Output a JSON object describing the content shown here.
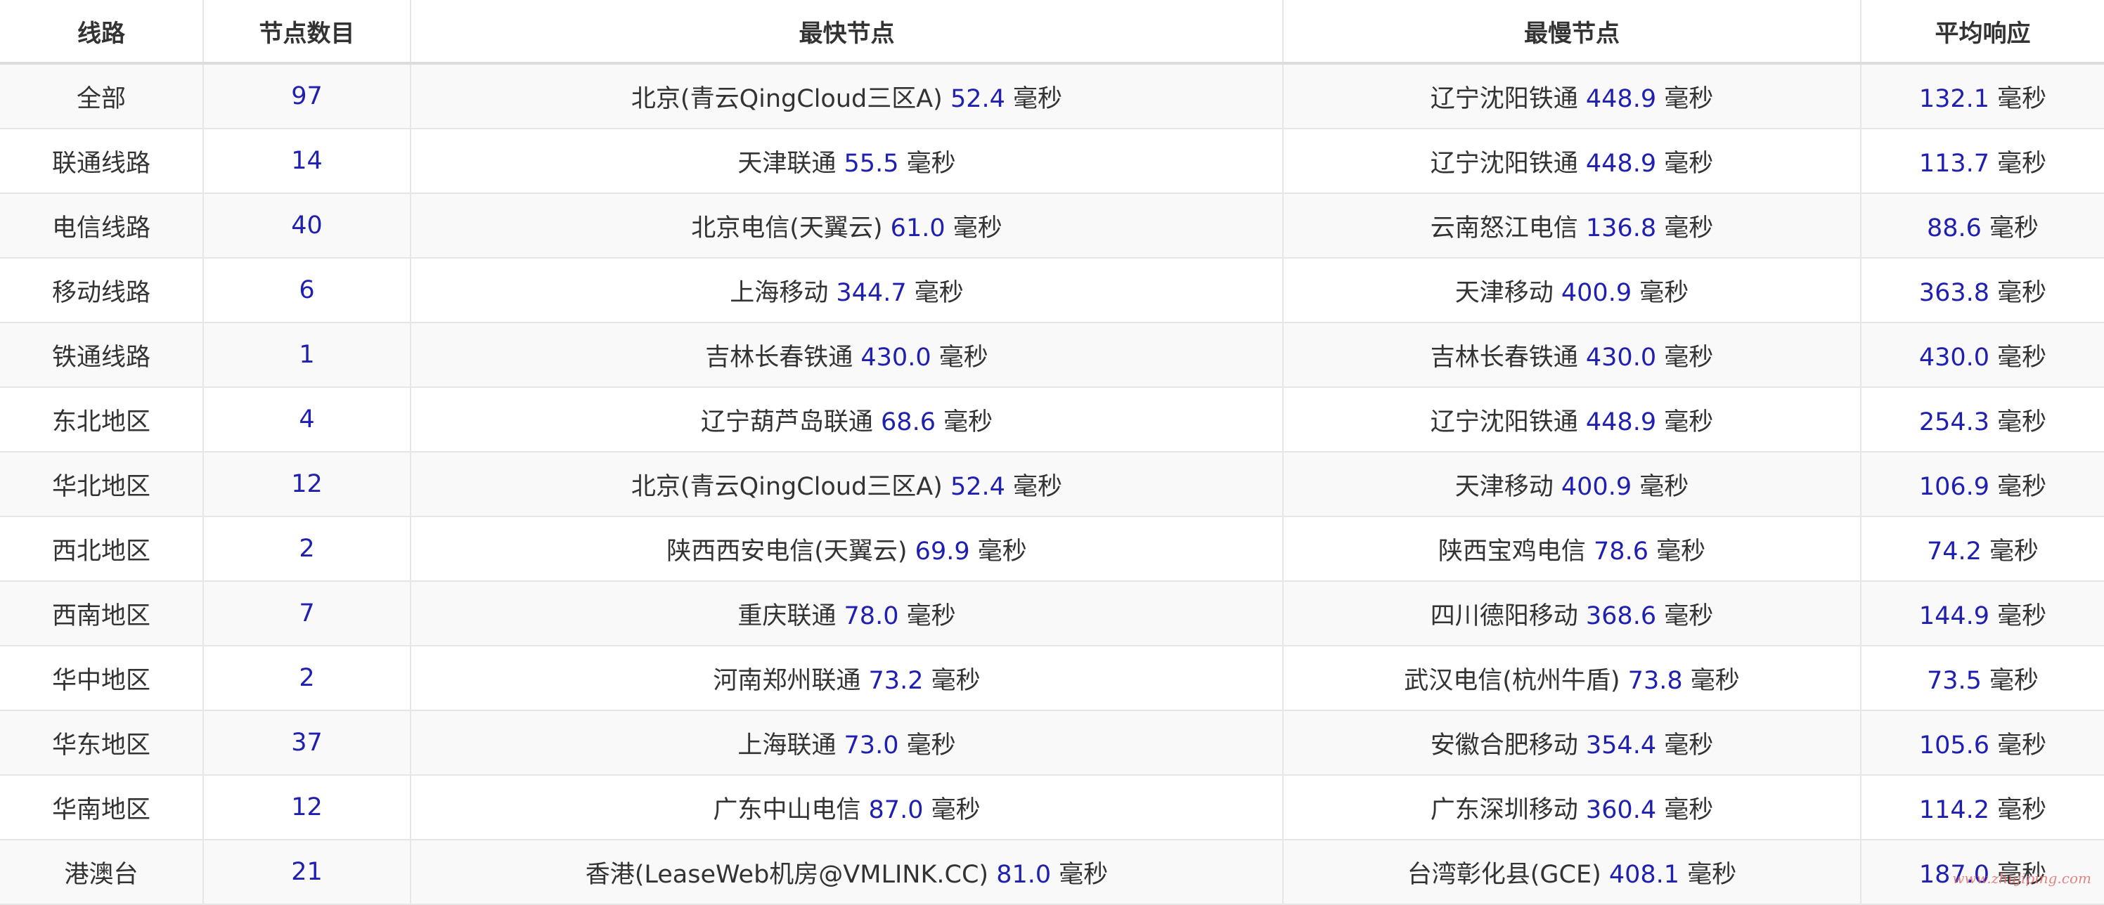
{
  "table": {
    "headers": [
      "线路",
      "节点数目",
      "最快节点",
      "最慢节点",
      "平均响应"
    ],
    "unit": "毫秒",
    "rows": [
      {
        "line": "全部",
        "count": "97",
        "fast_name": "北京(青云QingCloud三区A)",
        "fast_ms": "52.4",
        "slow_name": "辽宁沈阳铁通",
        "slow_ms": "448.9",
        "avg_ms": "132.1"
      },
      {
        "line": "联通线路",
        "count": "14",
        "fast_name": "天津联通",
        "fast_ms": "55.5",
        "slow_name": "辽宁沈阳铁通",
        "slow_ms": "448.9",
        "avg_ms": "113.7"
      },
      {
        "line": "电信线路",
        "count": "40",
        "fast_name": "北京电信(天翼云)",
        "fast_ms": "61.0",
        "slow_name": "云南怒江电信",
        "slow_ms": "136.8",
        "avg_ms": "88.6"
      },
      {
        "line": "移动线路",
        "count": "6",
        "fast_name": "上海移动",
        "fast_ms": "344.7",
        "slow_name": "天津移动",
        "slow_ms": "400.9",
        "avg_ms": "363.8"
      },
      {
        "line": "铁通线路",
        "count": "1",
        "fast_name": "吉林长春铁通",
        "fast_ms": "430.0",
        "slow_name": "吉林长春铁通",
        "slow_ms": "430.0",
        "avg_ms": "430.0"
      },
      {
        "line": "东北地区",
        "count": "4",
        "fast_name": "辽宁葫芦岛联通",
        "fast_ms": "68.6",
        "slow_name": "辽宁沈阳铁通",
        "slow_ms": "448.9",
        "avg_ms": "254.3"
      },
      {
        "line": "华北地区",
        "count": "12",
        "fast_name": "北京(青云QingCloud三区A)",
        "fast_ms": "52.4",
        "slow_name": "天津移动",
        "slow_ms": "400.9",
        "avg_ms": "106.9"
      },
      {
        "line": "西北地区",
        "count": "2",
        "fast_name": "陕西西安电信(天翼云)",
        "fast_ms": "69.9",
        "slow_name": "陕西宝鸡电信",
        "slow_ms": "78.6",
        "avg_ms": "74.2"
      },
      {
        "line": "西南地区",
        "count": "7",
        "fast_name": "重庆联通",
        "fast_ms": "78.0",
        "slow_name": "四川德阳移动",
        "slow_ms": "368.6",
        "avg_ms": "144.9"
      },
      {
        "line": "华中地区",
        "count": "2",
        "fast_name": "河南郑州联通",
        "fast_ms": "73.2",
        "slow_name": "武汉电信(杭州牛盾)",
        "slow_ms": "73.8",
        "avg_ms": "73.5"
      },
      {
        "line": "华东地区",
        "count": "37",
        "fast_name": "上海联通",
        "fast_ms": "73.0",
        "slow_name": "安徽合肥移动",
        "slow_ms": "354.4",
        "avg_ms": "105.6"
      },
      {
        "line": "华南地区",
        "count": "12",
        "fast_name": "广东中山电信",
        "fast_ms": "87.0",
        "slow_name": "广东深圳移动",
        "slow_ms": "360.4",
        "avg_ms": "114.2"
      },
      {
        "line": "港澳台",
        "count": "21",
        "fast_name": "香港(LeaseWeb机房@VMLINK.CC)",
        "fast_ms": "81.0",
        "slow_name": "台湾彰化县(GCE)",
        "slow_ms": "408.1",
        "avg_ms": "187.0"
      }
    ]
  },
  "watermark": "www.zhujiping.com",
  "colors": {
    "value_blue": "#1f1fb0",
    "text": "#333333",
    "stripe": "#f9f9f9",
    "border": "#e6e6e6",
    "watermark": "#e07070"
  }
}
